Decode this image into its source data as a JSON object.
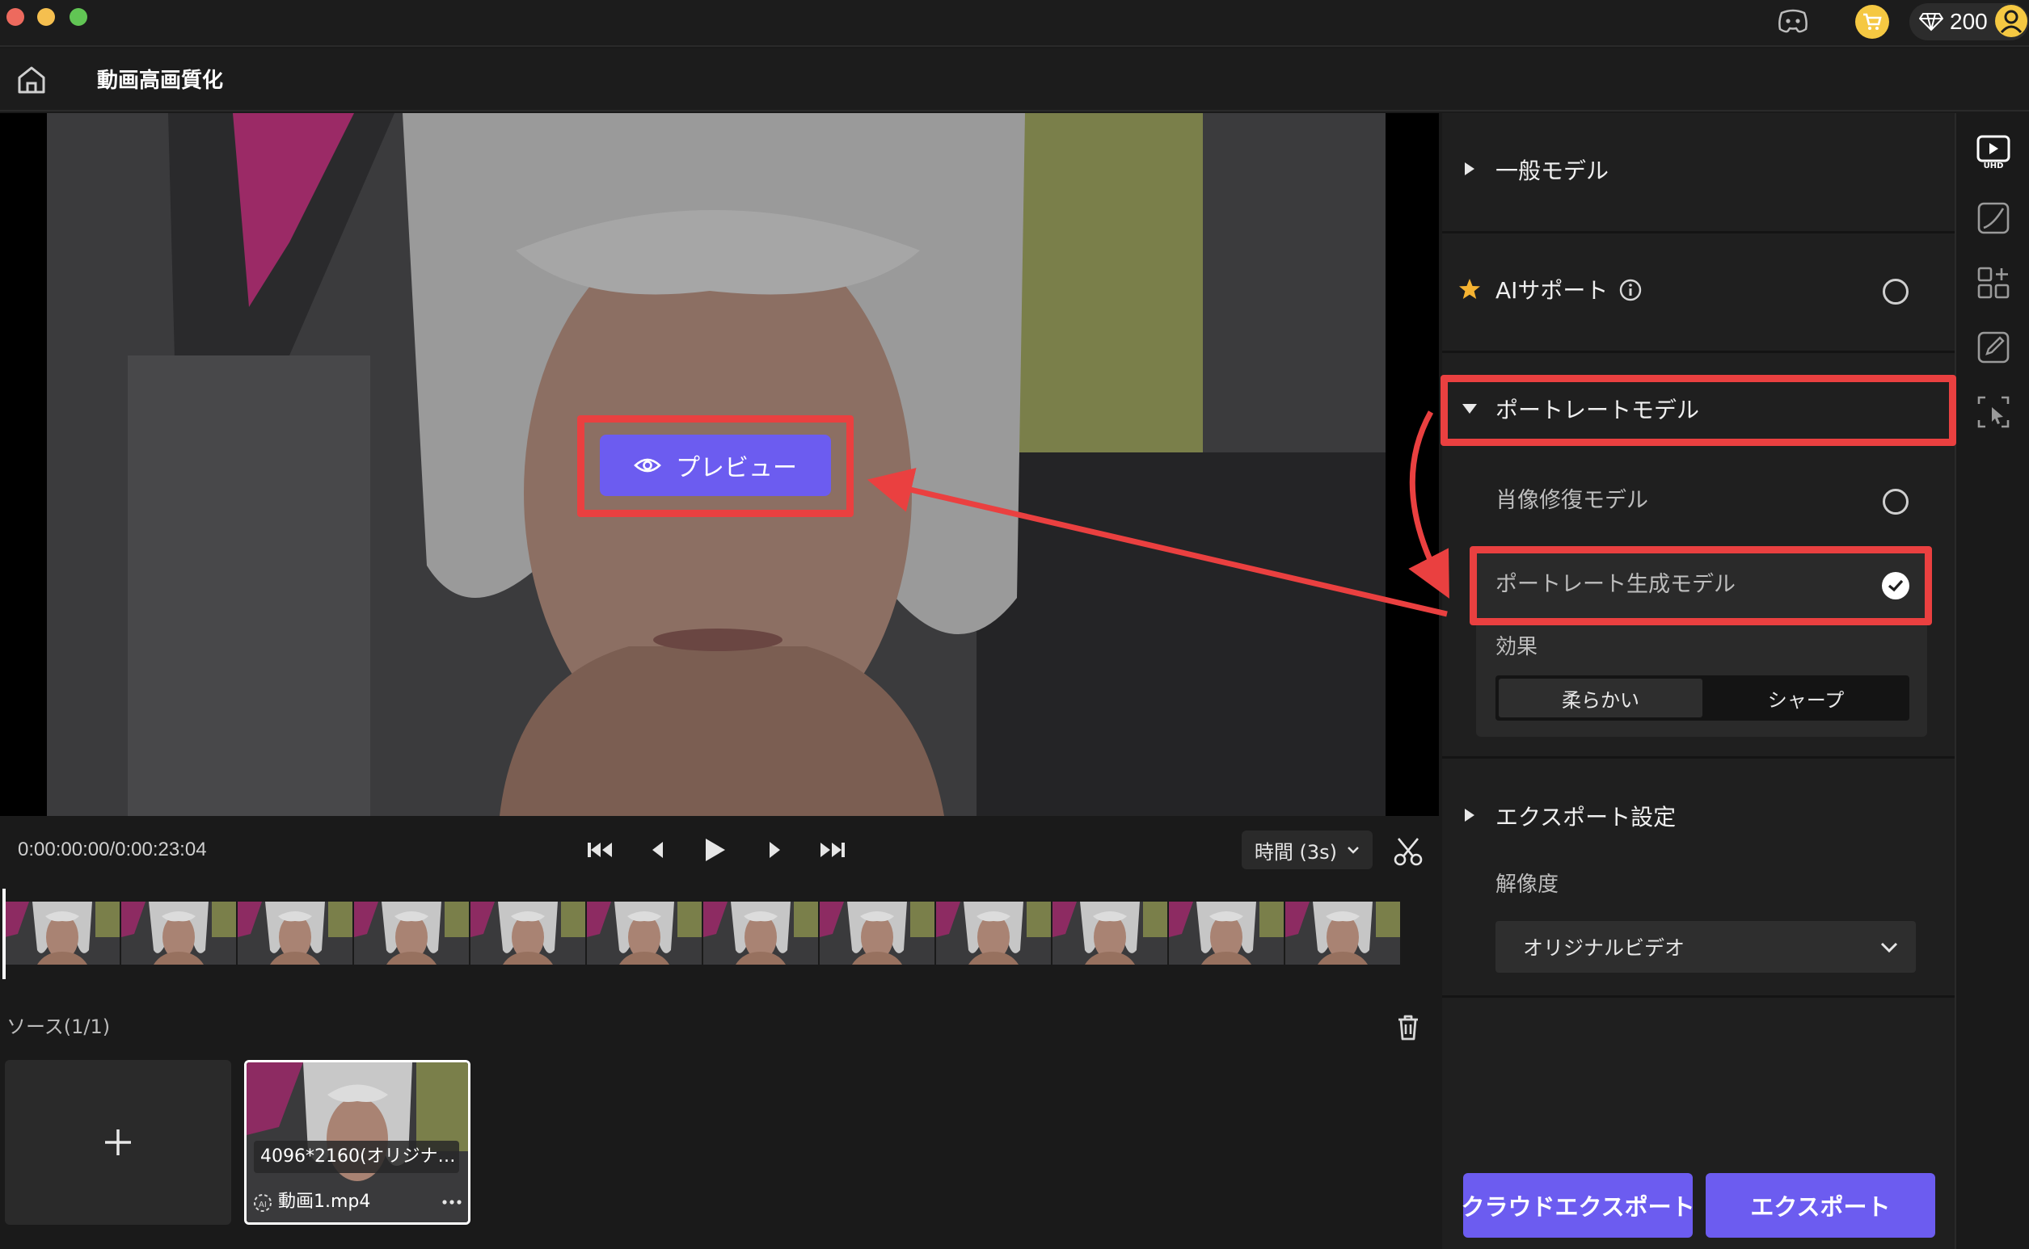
{
  "titlebar": {
    "credits": "200"
  },
  "header": {
    "title": "動画高画質化"
  },
  "preview": {
    "label": "プレビュー"
  },
  "player": {
    "time": "0:00:00:00/0:00:23:04",
    "interval": "時間 (3s)"
  },
  "source": {
    "title": "ソース(1/1)",
    "media": {
      "resolution": "4096*2160(オリジナ…",
      "filename": "動画1.mp4"
    }
  },
  "panel": {
    "general_model": "一般モデル",
    "ai_support": "AIサポート",
    "portrait_model": "ポートレートモデル",
    "options": [
      {
        "label": "肖像修復モデル",
        "selected": false
      },
      {
        "label": "ポートレート生成モデル",
        "selected": true
      }
    ],
    "effect": {
      "label": "効果",
      "choices": [
        "柔らかい",
        "シャープ"
      ],
      "selected": "柔らかい"
    },
    "export_settings": "エクスポート設定",
    "resolution": {
      "label": "解像度",
      "value": "オリジナルビデオ"
    },
    "cloud_export": "クラウドエクスポート",
    "export": "エクスポート"
  },
  "colors": {
    "accent": "#6c5cf0",
    "annotation": "#ea4040",
    "panel_bg": "#1f1f1f"
  },
  "toolbar": {
    "icons": [
      "uhd-video-icon",
      "curve-icon",
      "add-widget-icon",
      "edit-icon",
      "select-enhance-icon"
    ]
  }
}
